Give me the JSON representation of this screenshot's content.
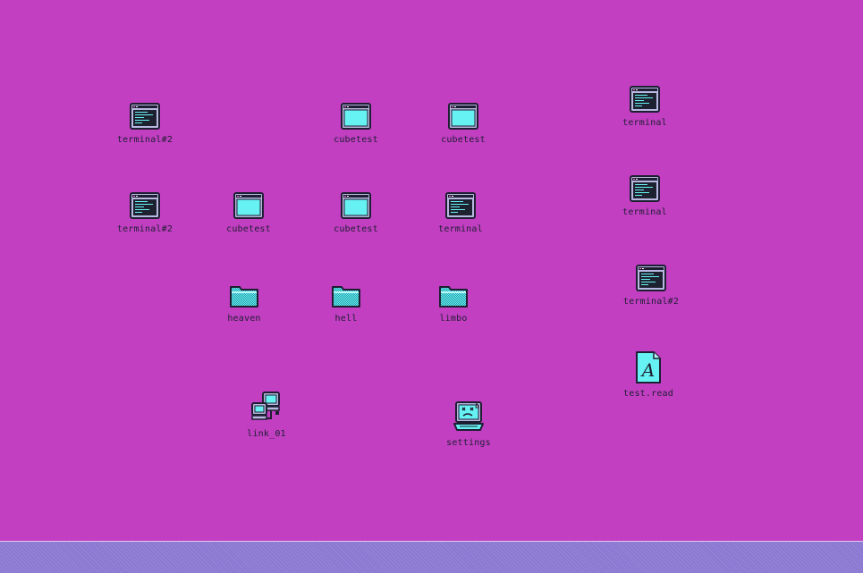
{
  "desktop": {
    "background_color": "#c23fc2",
    "icons": {
      "terminal2_a": {
        "label": "terminal#2",
        "icon": "terminal-icon"
      },
      "cubetest_a": {
        "label": "cubetest",
        "icon": "window-icon"
      },
      "cubetest_b": {
        "label": "cubetest",
        "icon": "window-icon"
      },
      "terminal_a": {
        "label": "terminal",
        "icon": "terminal-icon"
      },
      "terminal2_b": {
        "label": "terminal#2",
        "icon": "terminal-icon"
      },
      "cubetest_c": {
        "label": "cubetest",
        "icon": "window-icon"
      },
      "cubetest_d": {
        "label": "cubetest",
        "icon": "window-icon"
      },
      "terminal_b": {
        "label": "terminal",
        "icon": "terminal-icon"
      },
      "terminal_c": {
        "label": "terminal",
        "icon": "terminal-icon"
      },
      "heaven": {
        "label": "heaven",
        "icon": "folder-icon"
      },
      "hell": {
        "label": "hell",
        "icon": "folder-icon"
      },
      "limbo": {
        "label": "limbo",
        "icon": "folder-icon"
      },
      "terminal2_c": {
        "label": "terminal#2",
        "icon": "terminal-icon"
      },
      "test_read": {
        "label": "test.read",
        "icon": "document-icon"
      },
      "link_01": {
        "label": "link_01",
        "icon": "network-icon"
      },
      "settings": {
        "label": "settings",
        "icon": "settings-computer-icon"
      }
    }
  },
  "taskbar": {
    "color": "#8a78d2"
  },
  "colors": {
    "icon_outline": "#1e1e32",
    "icon_cyan": "#66f2f2",
    "terminal_screen": "#1e2230",
    "label_text": "#1e1e32"
  }
}
